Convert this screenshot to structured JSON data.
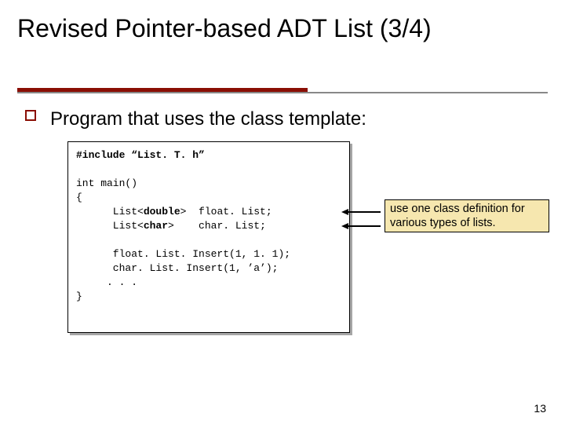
{
  "title": "Revised Pointer-based ADT List (3/4)",
  "body_text": "Program that uses the class template:",
  "code": {
    "line1": "#include “List. T. h”",
    "line2": "",
    "line3": "int main()",
    "line4": "{",
    "line5a": "      List<",
    "line5b": "double",
    "line5c": ">  float. List;",
    "line6a": "      List<",
    "line6b": "char",
    "line6c": ">    char. List;",
    "line7": "",
    "line8": "      float. List. Insert(1, 1. 1);",
    "line9": "      char. List. Insert(1, ’a’);",
    "line10": "     . . .",
    "line11": "}"
  },
  "callout": "use one class definition for various types of lists.",
  "page_number": "13"
}
